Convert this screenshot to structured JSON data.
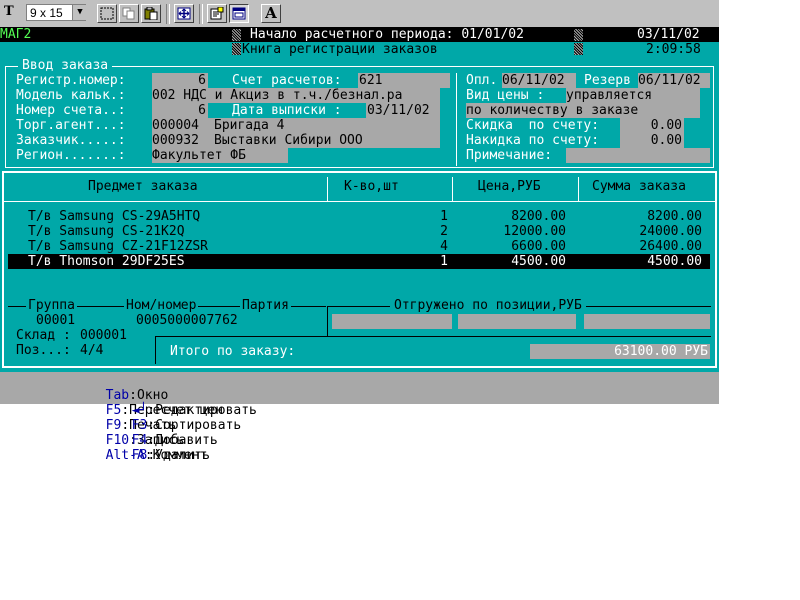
{
  "toolbar": {
    "font_icon_glyph": "T",
    "font_size": "9 x 15",
    "font_button_glyph": "A",
    "icons": [
      "mark-icon",
      "copy-icon",
      "paste-icon",
      "fullscreen-icon",
      "properties-icon",
      "background-icon",
      "font-icon"
    ]
  },
  "header": {
    "app_name": "МАГ2",
    "period_label": "Начало расчетного периода: 01/01/02",
    "date": "03/11/02",
    "title": "Книга регистрации заказов",
    "time": "2:09:58"
  },
  "order_form": {
    "frame_title": "Ввод заказа",
    "reg_number_label": "Регистр.номер:",
    "reg_number_value": "6",
    "account_label": "Счет расчетов:",
    "account_value": "621",
    "calc_model_label": "Модель кальк.:",
    "calc_model_value": "002 НДС и Акциз в т.ч./безнал.ра",
    "invoice_label": "Номер счета..:",
    "invoice_value": "6",
    "issue_date_label": "Дата выписки :",
    "issue_date_value": "03/11/02",
    "agent_label": "Торг.агент...:",
    "agent_code": "000004",
    "agent_name": "Бригада 4",
    "customer_label": "Заказчик.....:",
    "customer_code": "000932",
    "customer_name": "Выставки Сибири ООО",
    "region_label": "Регион.......:",
    "region_value": "Факультет ФБ",
    "paid_label": "Опл.",
    "paid_value": "06/11/02",
    "reserve_label": "Резерв",
    "reserve_value": "06/11/02",
    "price_type_label": "Вид цены :",
    "price_type_value_1": "управляется",
    "price_type_value_2": "по количеству в заказе",
    "discount_label": "Скидка  по счету:",
    "discount_value": "0.00",
    "markup_label": "Накидка по счету:",
    "markup_value": "0.00",
    "note_label": "Примечание:",
    "note_value": ""
  },
  "items_table": {
    "columns": [
      "Предмет заказа",
      "К-во,шт",
      "Цена,РУБ",
      "Сумма заказа"
    ],
    "rows": [
      {
        "name": "Т/в Samsung CS-29A5HTQ",
        "qty": "1",
        "price": "8200.00",
        "total": "8200.00"
      },
      {
        "name": "Т/в Samsung CS-21K2Q",
        "qty": "2",
        "price": "12000.00",
        "total": "24000.00"
      },
      {
        "name": "Т/в Samsung CZ-21F12ZSR",
        "qty": "4",
        "price": "6600.00",
        "total": "26400.00"
      },
      {
        "name": "Т/в Thomson 29DF25ES",
        "qty": "1",
        "price": "4500.00",
        "total": "4500.00"
      }
    ],
    "selected_row": 3
  },
  "details": {
    "group_label": "Группа",
    "nomnumber_label": "Ном/номер",
    "batch_label": "Партия",
    "group_value": "00001",
    "nomnumber_value": "0005000007762",
    "shipped_label": "Отгружено по позиции,РУБ",
    "warehouse_label": "Склад :",
    "warehouse_value": "000001",
    "position_label": "Поз...:",
    "position_value": "4/4",
    "total_label": "Итого по заказу:",
    "total_value": "63100.00 РУБ"
  },
  "hotkeys": {
    "line1": [
      {
        "key": "Tab",
        "action": ":Окно"
      },
      {
        "key": "F5",
        "action": ":Пересчет цен"
      },
      {
        "key": "F9",
        "action": ":Печать"
      },
      {
        "key": "F10",
        "action": ":Запись"
      },
      {
        "key": "Alt-A",
        "action": ":Коммент"
      }
    ],
    "line2": [
      {
        "key": "◄┘",
        "action": ":Редактировать"
      },
      {
        "key": "F3",
        "action": ":Сортировать"
      },
      {
        "key": "F4",
        "action": ":Добавить"
      },
      {
        "key": "F8",
        "action": ":Удалить"
      }
    ]
  },
  "colors": {
    "background": "#00a8a8",
    "highlight": "#000000",
    "field": "#a8a8a8",
    "hotkey": "#0000a8",
    "app_name": "#55ff55"
  }
}
